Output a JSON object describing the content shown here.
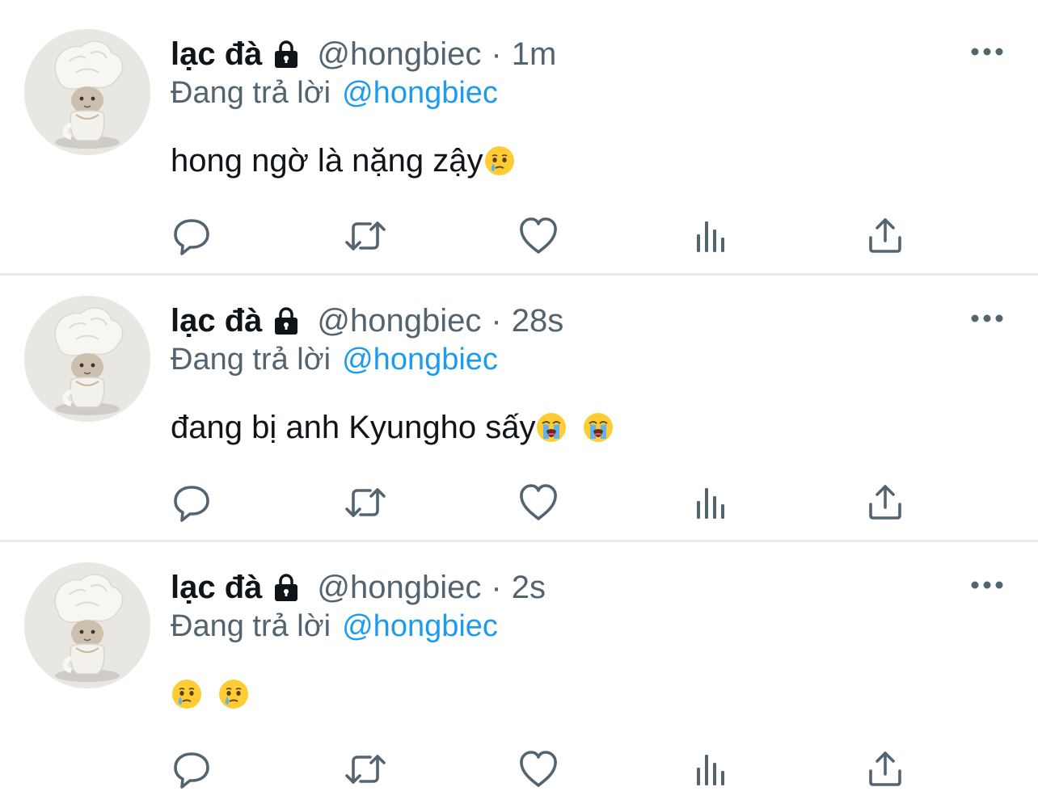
{
  "colors": {
    "text_primary": "#0f1419",
    "text_secondary": "#536471",
    "accent": "#1d9bf0",
    "divider": "#e7e9ea",
    "icon": "#536471"
  },
  "tweets": [
    {
      "name": "lạc đà",
      "lock_icon": "lock-icon",
      "handle": "@hongbiec",
      "separator": "·",
      "time": "1m",
      "reply_prefix": "Đang trả lời",
      "reply_to": "@hongbiec",
      "text": "hong ngờ là nặng zậy",
      "emojis": [
        "face-holding-back-tears"
      ],
      "actions": [
        "reply-icon",
        "retweet-icon",
        "like-icon",
        "analytics-icon",
        "share-icon"
      ],
      "more_icon": "more-icon"
    },
    {
      "name": "lạc đà",
      "lock_icon": "lock-icon",
      "handle": "@hongbiec",
      "separator": "·",
      "time": "28s",
      "reply_prefix": "Đang trả lời",
      "reply_to": "@hongbiec",
      "text": "đang bị anh Kyungho sấy",
      "emojis": [
        "loudly-crying-face",
        "loudly-crying-face"
      ],
      "actions": [
        "reply-icon",
        "retweet-icon",
        "like-icon",
        "analytics-icon",
        "share-icon"
      ],
      "more_icon": "more-icon"
    },
    {
      "name": "lạc đà",
      "lock_icon": "lock-icon",
      "handle": "@hongbiec",
      "separator": "·",
      "time": "2s",
      "reply_prefix": "Đang trả lời",
      "reply_to": "@hongbiec",
      "text": "",
      "emojis": [
        "face-holding-back-tears",
        "face-holding-back-tears"
      ],
      "actions": [
        "reply-icon",
        "retweet-icon",
        "like-icon",
        "analytics-icon",
        "share-icon"
      ],
      "more_icon": "more-icon"
    }
  ]
}
